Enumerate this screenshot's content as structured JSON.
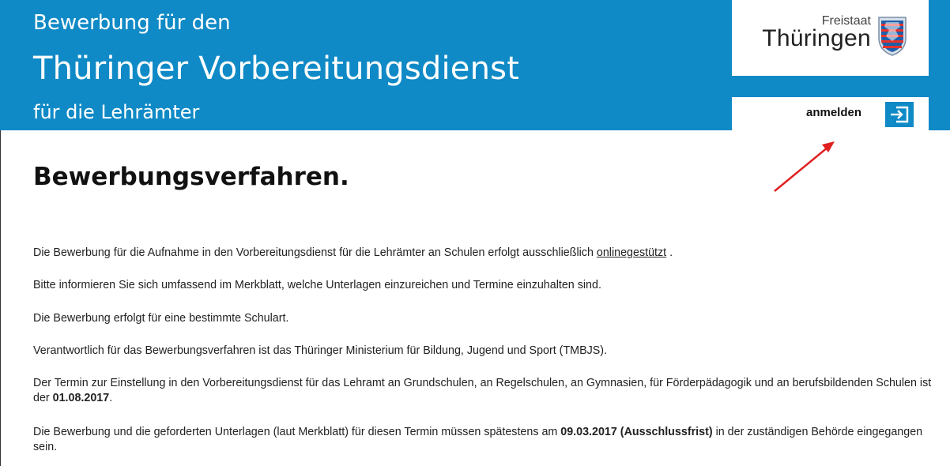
{
  "header": {
    "line1": "Bewerbung für den",
    "line2": "Thüringer Vorbereitungsdienst",
    "line3": "für die Lehrämter",
    "logo": {
      "small": "Freistaat",
      "big": "Thüringen"
    },
    "login_label": "anmelden",
    "login_icon": "sign-in-icon",
    "accent_color": "#0f8ac6"
  },
  "main": {
    "title": "Bewerbungsverfahren.",
    "p1_text": "Die Bewerbung für die Aufnahme in den Vorbereitungsdienst für die Lehrämter an Schulen erfolgt ausschließlich ",
    "p1_link": "onlinegestützt",
    "p1_end": " .",
    "p2": "Bitte informieren Sie sich umfassend im Merkblatt, welche Unterlagen einzureichen und Termine einzuhalten sind.",
    "p3": "Die Bewerbung erfolgt für eine bestimmte Schulart.",
    "p4": "Verantwortlich für das Bewerbungsverfahren ist das Thüringer Ministerium für Bildung, Jugend und Sport (TMBJS).",
    "p5_text": "Der Termin zur Einstellung in den Vorbereitungsdienst für das Lehramt an Grundschulen, an Regelschulen, an Gymnasien, für Förderpädagogik und an berufsbildenden Schulen ist der ",
    "p5_date": "01.08.2017",
    "p5_end": ".",
    "p6_text": "Die Bewerbung und die geforderten Unterlagen (laut Merkblatt) für diesen Termin müssen spätestens am ",
    "p6_date": "09.03.2017 (Ausschlussfrist)",
    "p6_end": " in der zuständigen Behörde eingegangen sein."
  },
  "annotation": {
    "arrow_color": "#e02020"
  }
}
